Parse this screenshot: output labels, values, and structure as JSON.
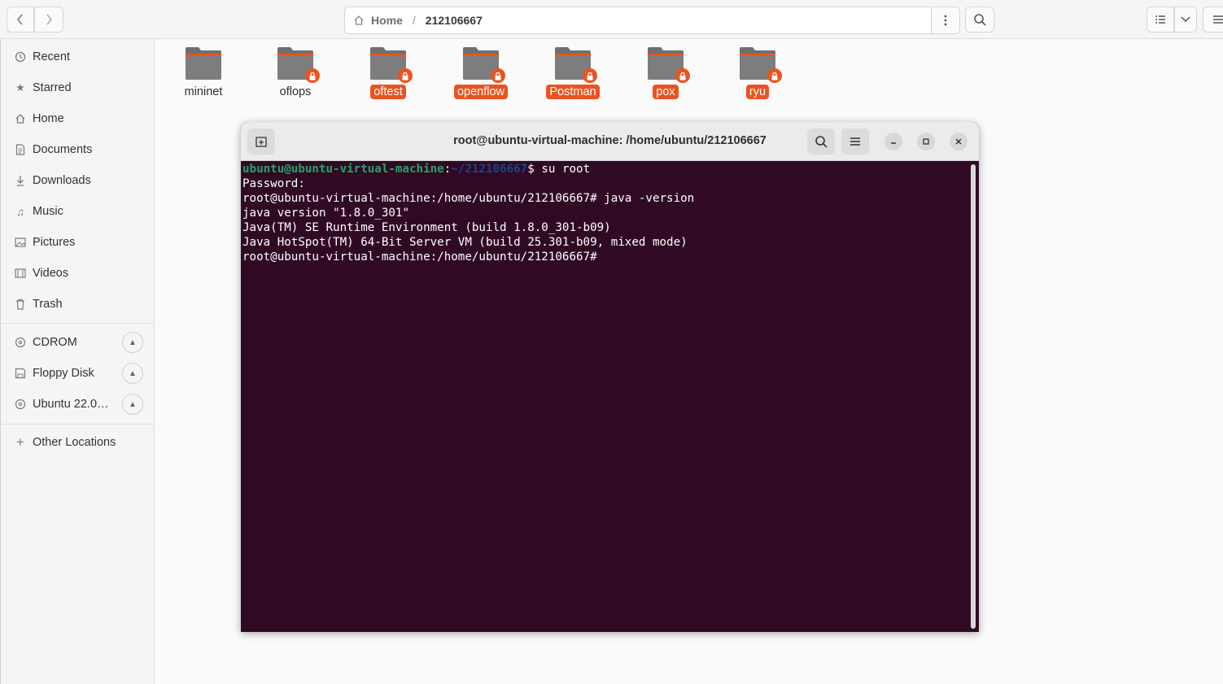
{
  "header": {
    "path": {
      "home_label": "Home",
      "current": "212106667"
    }
  },
  "sidebar": {
    "items": [
      {
        "label": "Recent",
        "icon": "clock-icon"
      },
      {
        "label": "Starred",
        "icon": "star-icon"
      },
      {
        "label": "Home",
        "icon": "home-icon"
      },
      {
        "label": "Documents",
        "icon": "document-icon"
      },
      {
        "label": "Downloads",
        "icon": "download-icon"
      },
      {
        "label": "Music",
        "icon": "music-icon"
      },
      {
        "label": "Pictures",
        "icon": "picture-icon"
      },
      {
        "label": "Videos",
        "icon": "video-icon"
      },
      {
        "label": "Trash",
        "icon": "trash-icon"
      }
    ],
    "devices": [
      {
        "label": "CDROM"
      },
      {
        "label": "Floppy Disk"
      },
      {
        "label": "Ubuntu 22.0…"
      }
    ],
    "other_locations": "Other Locations"
  },
  "folders": [
    {
      "name": "mininet",
      "locked": false,
      "selected": false
    },
    {
      "name": "oflops",
      "locked": true,
      "selected": false
    },
    {
      "name": "oftest",
      "locked": true,
      "selected": true
    },
    {
      "name": "openflow",
      "locked": true,
      "selected": true
    },
    {
      "name": "Postman",
      "locked": true,
      "selected": true
    },
    {
      "name": "pox",
      "locked": true,
      "selected": true
    },
    {
      "name": "ryu",
      "locked": true,
      "selected": true
    }
  ],
  "terminal": {
    "title": "root@ubuntu-virtual-machine: /home/ubuntu/212106667",
    "prompt_user": "ubuntu@ubuntu-virtual-machine",
    "prompt_path": "~/212106667",
    "prompt_cmd": "$ su root",
    "lines": [
      "Password:",
      "root@ubuntu-virtual-machine:/home/ubuntu/212106667# java -version",
      "java version \"1.8.0_301\"",
      "Java(TM) SE Runtime Environment (build 1.8.0_301-b09)",
      "Java HotSpot(TM) 64-Bit Server VM (build 25.301-b09, mixed mode)",
      "root@ubuntu-virtual-machine:/home/ubuntu/212106667#"
    ]
  },
  "colors": {
    "accent": "#e95420",
    "terminal_bg": "#300a24",
    "prompt_user": "#26a269",
    "prompt_path": "#12488b"
  }
}
